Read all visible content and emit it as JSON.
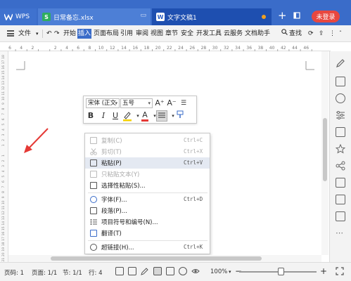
{
  "titlebar": {
    "tabs": [
      {
        "icon": "wps-logo-icon",
        "label": "WPS"
      },
      {
        "icon": "spreadsheet-icon",
        "label": "日常备忘.xlsx"
      },
      {
        "icon": "document-icon",
        "label": "文字文稿1"
      }
    ],
    "add_tab": "+",
    "login_label": "未登录"
  },
  "menubar": {
    "file_label": "文件",
    "items": [
      "开始",
      "插入",
      "页面布局",
      "引用",
      "审阅",
      "视图",
      "章节",
      "安全",
      "开发工具",
      "云服务",
      "文档助手"
    ],
    "active_item": "插入",
    "search_label": "查找"
  },
  "ruler": {
    "h_numbers": [
      "6",
      "4",
      "2",
      "",
      "2",
      "4",
      "6",
      "8",
      "10",
      "12",
      "14",
      "16",
      "18",
      "20",
      "22",
      "24",
      "26",
      "28",
      "30",
      "32",
      "34",
      "36",
      "38",
      "40",
      "42",
      "44",
      "46"
    ],
    "v_numbers": [
      "18",
      "17",
      "16",
      "15",
      "14",
      "13",
      "12",
      "11",
      "10",
      "9",
      "8",
      "7",
      "6",
      "5",
      "4",
      "3",
      "2",
      "1",
      "",
      "1",
      "2",
      "3",
      "4",
      "5",
      "6",
      "7",
      "8",
      "9",
      "10",
      "11",
      "12",
      "13",
      "14",
      "15",
      "16",
      "17",
      "18",
      "19",
      "20",
      "21",
      "22",
      "23",
      "24",
      "25",
      "26",
      "27",
      "28",
      "29",
      "30",
      "31",
      "32",
      "33",
      "34",
      "35",
      "36"
    ]
  },
  "mini_toolbar": {
    "font_name": "宋体 (正文",
    "font_size": "五号",
    "grow_font": "A⁺",
    "shrink_font": "A⁻",
    "bold": "B",
    "italic": "I",
    "underline": "U",
    "font_color": "A"
  },
  "context_menu": {
    "items": [
      {
        "label": "复制(C)",
        "shortcut": "Ctrl+C",
        "icon": "copy-icon",
        "disabled": true
      },
      {
        "label": "剪切(T)",
        "shortcut": "Ctrl+X",
        "icon": "cut-icon",
        "disabled": true
      },
      {
        "label": "粘贴(P)",
        "shortcut": "Ctrl+V",
        "icon": "paste-icon",
        "disabled": false,
        "highlighted": true
      },
      {
        "label": "只粘贴文本(Y)",
        "shortcut": "",
        "icon": "paste-text-icon",
        "disabled": true
      },
      {
        "label": "选择性粘贴(S)...",
        "shortcut": "",
        "icon": "paste-special-icon",
        "disabled": false
      },
      {
        "label": "字体(F)...",
        "shortcut": "Ctrl+D",
        "icon": "font-icon",
        "disabled": false
      },
      {
        "label": "段落(P)...",
        "shortcut": "",
        "icon": "paragraph-icon",
        "disabled": false
      },
      {
        "label": "项目符号和编号(N)...",
        "shortcut": "",
        "icon": "bullets-icon",
        "disabled": false
      },
      {
        "label": "翻译(T)",
        "shortcut": "",
        "icon": "translate-icon",
        "disabled": false
      },
      {
        "label": "超链接(H)...",
        "shortcut": "Ctrl+K",
        "icon": "hyperlink-icon",
        "disabled": false
      }
    ]
  },
  "statusbar": {
    "page_num": "页码: 1",
    "pages": "页面: 1/1",
    "section": "节: 1/1",
    "row": "行: 4",
    "zoom": "100%",
    "zoom_level": 1.0,
    "zoom_minus": "−",
    "zoom_plus": "+"
  },
  "colors": {
    "titlebar": "#3a6cc9",
    "active_tab": "#1e4fb0",
    "login_button": "#e8473f",
    "arrow": "#e53935",
    "menu_highlight": "#e4e9f2"
  }
}
